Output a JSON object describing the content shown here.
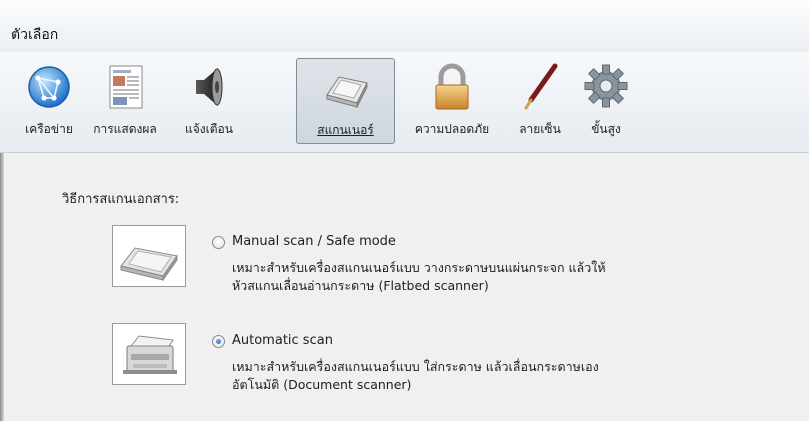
{
  "window": {
    "title": "ตัวเลือก"
  },
  "toolbar": {
    "items": [
      {
        "label": "เครือข่าย",
        "icon": "network-globe-icon"
      },
      {
        "label": "การแสดงผล",
        "icon": "display-document-icon"
      },
      {
        "label": "แจ้งเตือน",
        "icon": "speaker-icon"
      },
      {
        "label": "สแกนเนอร์",
        "icon": "scanner-icon",
        "active": true
      },
      {
        "label": "ความปลอดภัย",
        "icon": "padlock-icon"
      },
      {
        "label": "ลายเซ็น",
        "icon": "pen-icon"
      },
      {
        "label": "ขั้นสูง",
        "icon": "gear-icon"
      }
    ]
  },
  "scan": {
    "section_title": "วิธีการสแกนเอกสาร:",
    "options": [
      {
        "label": "Manual scan / Safe mode",
        "desc1": "เหมาะสำหรับเครื่องสแกนเนอร์แบบ วางกระดาษบนแผ่นกระจก แล้วให้",
        "desc2": "หัวสแกนเลื่อนอ่านกระดาษ (Flatbed scanner)",
        "selected": false
      },
      {
        "label": "Automatic scan",
        "desc1": "เหมาะสำหรับเครื่องสแกนเนอร์แบบ ใส่กระดาษ แล้วเลื่อนกระดาษเอง",
        "desc2": "อัตโนมัติ (Document scanner)",
        "selected": true
      }
    ]
  },
  "colors": {
    "accent": "#1c5ab8",
    "toolbar_bg": "#e6ebf1",
    "panel_bg": "#f0f0f0"
  }
}
